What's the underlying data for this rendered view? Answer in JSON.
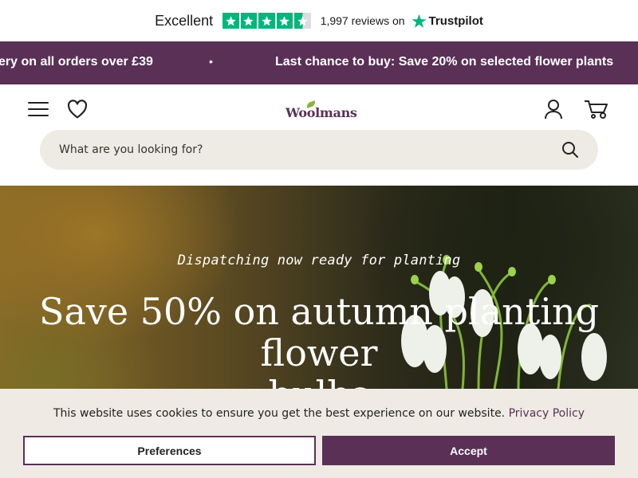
{
  "trustpilot": {
    "rating_word": "Excellent",
    "reviews": "1,997 reviews on",
    "brand": "Trustpilot",
    "star_color": "#00b67a"
  },
  "promo": {
    "items": [
      "ery on all orders over £39",
      "Last chance to buy: Save 20% on selected flower plants"
    ],
    "separator": "•",
    "background": "#5a3057"
  },
  "header": {
    "logo_text": "Woolmans",
    "menu_icon": "hamburger-menu-icon",
    "wishlist_icon": "heart-icon",
    "account_icon": "user-icon",
    "basket_icon": "cart-icon"
  },
  "search": {
    "placeholder": "What are you looking for?",
    "icon": "search-icon"
  },
  "hero": {
    "subtitle": "Dispatching now ready for planting",
    "title_line1": "Save 50% on autumn planting",
    "title_line2": "flower",
    "title_line3": "bulbs"
  },
  "cookie": {
    "message": "This website uses cookies to ensure you get the best experience on our website.",
    "link": "Privacy Policy",
    "preferences": "Preferences",
    "accept": "Accept"
  }
}
